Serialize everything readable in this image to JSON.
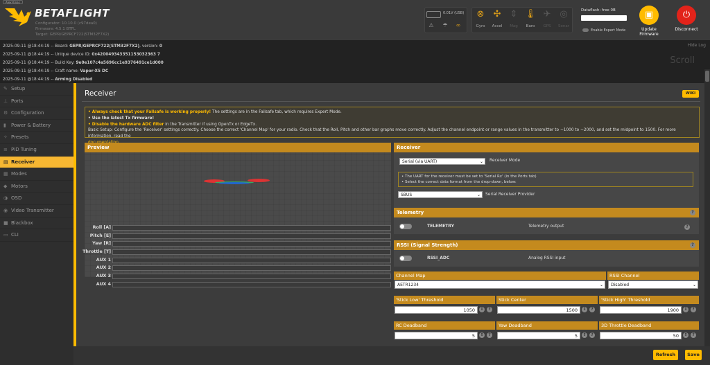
{
  "header": {
    "badge": "Alex Kinas",
    "brand": "BETAFLIGHT",
    "configurator": "Configurator: 10.10.0 (c97dea0)",
    "firmware": "Firmware: 4.5.1 BTFL",
    "target": "Target: GEPR/GEPRCF722(STM32F7X2)",
    "battery": "0.01V (USB)",
    "sensors": [
      {
        "label": "Gyro",
        "icon": "gyro-icon",
        "active": true
      },
      {
        "label": "Accel",
        "icon": "accel-icon",
        "active": true
      },
      {
        "label": "Mag",
        "icon": "mag-icon",
        "active": false
      },
      {
        "label": "Baro",
        "icon": "baro-icon",
        "active": true
      },
      {
        "label": "GPS",
        "icon": "gps-icon",
        "active": false
      },
      {
        "label": "Sonar",
        "icon": "sonar-icon",
        "active": false
      }
    ],
    "dataflash": "Dataflash: free 0B",
    "expert_mode": "Enable Expert Mode",
    "update_firmware": "Update Firmware",
    "disconnect": "Disconnect",
    "colors": {
      "accent": "#ffbb00",
      "disconnect": "#e2231a"
    }
  },
  "log": {
    "hide": "Hide Log",
    "scroll": "Scroll",
    "lines": [
      {
        "ts": "2025-09-11 @18:44:19 -- Board: ",
        "val": "GEPR/GEPRCF722(STM32F7X2)",
        "rest": ", version: ",
        "val2": "0"
      },
      {
        "ts": "2025-09-11 @18:44:19 -- Unique device ID: ",
        "val": "0x420049343351153032363 7",
        "rest": "",
        "val2": ""
      },
      {
        "ts": "2025-09-11 @18:44:19 -- Build Key: ",
        "val": "9e0e107c4a5696cc1e9376491ce1d000",
        "rest": "",
        "val2": ""
      },
      {
        "ts": "2025-09-11 @18:44:19 -- Craft name: ",
        "val": "Vapor-X5 DC",
        "rest": "",
        "val2": ""
      },
      {
        "ts": "2025-09-11 @18:44:19 -- ",
        "val": "Arming Disabled",
        "rest": "",
        "val2": ""
      }
    ]
  },
  "nav": [
    {
      "label": "Setup",
      "icon": "wrench-icon"
    },
    {
      "label": "Ports",
      "icon": "plug-icon"
    },
    {
      "label": "Configuration",
      "icon": "gear-icon"
    },
    {
      "label": "Power & Battery",
      "icon": "battery-icon"
    },
    {
      "label": "Presets",
      "icon": "presets-icon"
    },
    {
      "label": "PID Tuning",
      "icon": "sliders-icon"
    },
    {
      "label": "Receiver",
      "icon": "receiver-icon",
      "active": true
    },
    {
      "label": "Modes",
      "icon": "modes-icon"
    },
    {
      "label": "Motors",
      "icon": "motor-icon"
    },
    {
      "label": "OSD",
      "icon": "osd-icon"
    },
    {
      "label": "Video Transmitter",
      "icon": "vtx-icon"
    },
    {
      "label": "Blackbox",
      "icon": "blackbox-icon"
    },
    {
      "label": "CLI",
      "icon": "cli-icon"
    }
  ],
  "page": {
    "title": "Receiver",
    "wiki": "WIKI",
    "note": {
      "l1_bold": "• Always check that your Failsafe is working properly!",
      "l1_rest": " The settings are in the Failsafe tab, which requires Expert Mode.",
      "l2": "• Use the latest Tx firmware!",
      "l3_bold": "• Disable the hardware ADC filter",
      "l3_rest": " in the Transmitter if using OpenTx or EdgeTx.",
      "l4": "Basic Setup: Configure the 'Receiver' settings correctly. Choose the correct 'Channel Map' for your radio. Check that the Roll, Pitch and other bar graphs move correctly. Adjust the channel endpoint or range values in the transmitter to ~1000 to ~2000, and set the midpoint to 1500. For more information, read the",
      "l5": "documentation."
    },
    "preview": {
      "title": "Preview",
      "channels": [
        "Roll [A]",
        "Pitch [E]",
        "Yaw [R]",
        "Throttle [T]",
        "AUX 1",
        "AUX 2",
        "AUX 3",
        "AUX 4"
      ]
    },
    "receiver": {
      "title": "Receiver",
      "mode_value": "Serial (via UART)",
      "mode_label": "Receiver Mode",
      "info1": "• The UART for the receiver must be set to 'Serial Rx' (in the Ports tab)",
      "info2": "• Select the correct data format from the drop-down, below:",
      "provider_value": "SBUS",
      "provider_label": "Serial Receiver Provider"
    },
    "telemetry": {
      "title": "Telemetry",
      "feature": "TELEMETRY",
      "desc": "Telemetry output"
    },
    "rssi": {
      "title": "RSSI (Signal Strength)",
      "feature": "RSSI_ADC",
      "desc": "Analog RSSI input"
    },
    "channel_map": {
      "label": "Channel Map",
      "value": "AETR1234"
    },
    "rssi_channel": {
      "label": "RSSI Channel",
      "value": "Disabled"
    },
    "stick": {
      "low_label": "'Stick Low' Threshold",
      "low": "1050",
      "center_label": "Stick Center",
      "center": "1500",
      "high_label": "'Stick High' Threshold",
      "high": "1900"
    },
    "deadband": {
      "rc_label": "RC Deadband",
      "rc": "5",
      "yaw_label": "Yaw Deadband",
      "yaw": "5",
      "thr_label": "3D Throttle Deadband",
      "thr": "50"
    },
    "refresh": "Refresh",
    "save": "Save"
  }
}
